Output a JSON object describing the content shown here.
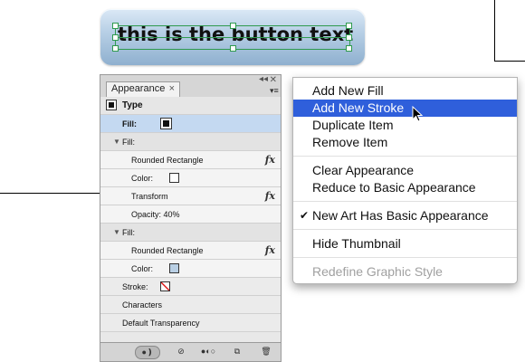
{
  "artwork": {
    "button_text": "this is the button text"
  },
  "panel": {
    "tab_label": "Appearance",
    "tab_close": "×",
    "close_glyph": "✕",
    "collapse_glyph": "◂◂",
    "menu_glyph": "▾≡",
    "rows": {
      "type": "Type",
      "fill_top": "Fill:",
      "fill1_header": "Fill:",
      "rounded_rect_1": "Rounded Rectangle",
      "color_1": "Color:",
      "transform": "Transform",
      "opacity": "Opacity: 40%",
      "fill2_header": "Fill:",
      "rounded_rect_2": "Rounded Rectangle",
      "color_2": "Color:",
      "stroke": "Stroke:",
      "characters": "Characters",
      "default_transparency": "Default Transparency"
    },
    "fx_glyph": "fx",
    "colors": {
      "fill_top_swatch": "#111111",
      "color1_swatch": "#ffffff",
      "color2_swatch": "#b9cfe4",
      "stroke_swatch": "none-red-slash"
    },
    "bottom_icons": [
      "visibility-toggle-icon",
      "clear-icon",
      "reduce-icon",
      "duplicate-icon",
      "trash-icon"
    ]
  },
  "menu": {
    "items": [
      {
        "label": "Add New Fill"
      },
      {
        "label": "Add New Stroke"
      },
      {
        "label": "Duplicate Item"
      },
      {
        "label": "Remove Item"
      },
      {
        "label": "Clear Appearance"
      },
      {
        "label": "Reduce to Basic Appearance"
      },
      {
        "label": "New Art Has Basic Appearance"
      },
      {
        "label": "Hide Thumbnail"
      },
      {
        "label": "Redefine Graphic Style"
      }
    ],
    "check_glyph": "✔",
    "highlight_color": "#2f5fdb"
  }
}
